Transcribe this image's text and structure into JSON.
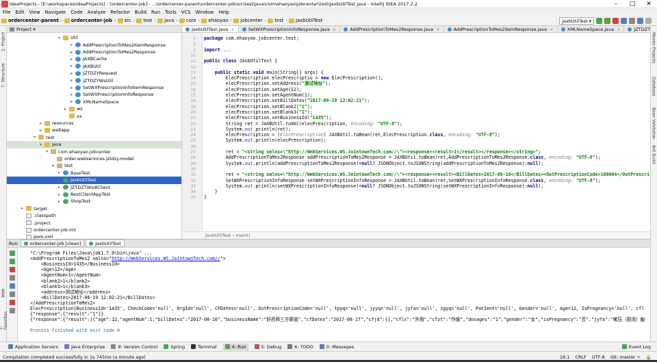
{
  "window": {
    "title": "IdeaProjects - [E:\\workspaces\\IdeaProjects] - [ordercenter-job] - ...\\ordercenter-parent\\ordercenter-job\\src\\test\\java\\com\\ehaoyao\\jobcenter\\test\\JaxbUtilTest.java - IntelliJ IDEA 2017.2.2"
  },
  "menu": [
    "File",
    "Edit",
    "View",
    "Navigate",
    "Code",
    "Analyze",
    "Refactor",
    "Build",
    "Run",
    "Tools",
    "VCS",
    "Window",
    "Help"
  ],
  "breadcrumbs": [
    "ordercenter-parent",
    "ordercenter-job",
    "src",
    "test",
    "java",
    "com",
    "ehaoyao",
    "jobcenter",
    "test",
    "JaxbUtilTest"
  ],
  "run_config": "JaxbUtilTest",
  "project_panel": {
    "label": "Project"
  },
  "tree": [
    {
      "label": "Util",
      "depth": 9,
      "type": "fld",
      "arrow": "▾"
    },
    {
      "label": "AddPrescriptionToMes2ItemResponse",
      "depth": 11,
      "type": "cls",
      "arrow": "▸"
    },
    {
      "label": "AddPrescriptionToMes2Response",
      "depth": 11,
      "type": "cls",
      "arrow": "▸"
    },
    {
      "label": "JAXBCache",
      "depth": 11,
      "type": "cls",
      "arrow": "▸"
    },
    {
      "label": "JAXBUtil",
      "depth": 11,
      "type": "cls",
      "arrow": "▸"
    },
    {
      "label": "JZTDZYRequest",
      "depth": 11,
      "type": "cls",
      "arrow": "▸"
    },
    {
      "label": "JZTDZYWsUtil",
      "depth": 11,
      "type": "cls",
      "arrow": "▸"
    },
    {
      "label": "SetWXPrescriptionInfoItemResponse",
      "depth": 11,
      "type": "cls",
      "arrow": "▸"
    },
    {
      "label": "SetWXPrescriptionInfoResponse",
      "depth": 11,
      "type": "cls",
      "arrow": "▸"
    },
    {
      "label": "XMLNameSpace",
      "depth": 11,
      "type": "cls",
      "arrow": "▸"
    },
    {
      "label": "ws",
      "depth": 10,
      "type": "fld",
      "arrow": "▸"
    },
    {
      "label": "xx",
      "depth": 10,
      "type": "fld",
      "arrow": ""
    },
    {
      "label": "resources",
      "depth": 6,
      "type": "fld",
      "arrow": "▸"
    },
    {
      "label": "webapp",
      "depth": 6,
      "type": "fld",
      "arrow": "▸"
    },
    {
      "label": "test",
      "depth": 5,
      "type": "fld",
      "arrow": "▾"
    },
    {
      "label": "java",
      "depth": 6,
      "type": "fld",
      "arrow": "▾",
      "hl": true
    },
    {
      "label": "com.ehaoyao.jobcenter",
      "depth": 7,
      "type": "pkg",
      "arrow": "▾"
    },
    {
      "label": "order.webservices.jztdzy.model",
      "depth": 8,
      "type": "pkg",
      "arrow": ""
    },
    {
      "label": "test",
      "depth": 8,
      "type": "pkg",
      "arrow": "▾"
    },
    {
      "label": "BaseTest",
      "depth": 9,
      "type": "cls",
      "arrow": "▸"
    },
    {
      "label": "JaxbUtilTest",
      "depth": 9,
      "type": "jun",
      "arrow": "▸",
      "sel": true
    },
    {
      "label": "JZTDZTWsdlClient",
      "depth": 9,
      "type": "jun",
      "arrow": "▸"
    },
    {
      "label": "RestClientAppTest",
      "depth": 9,
      "type": "jun",
      "arrow": "▸"
    },
    {
      "label": "ShopTest",
      "depth": 9,
      "type": "jun",
      "arrow": "▸"
    },
    {
      "label": "target",
      "depth": 3,
      "type": "fld",
      "arrow": "▸"
    },
    {
      "label": ".classpath",
      "depth": 3,
      "type": "file",
      "arrow": ""
    },
    {
      "label": ".project",
      "depth": 3,
      "type": "file",
      "arrow": ""
    },
    {
      "label": "ordercenter-job.iml",
      "depth": 3,
      "type": "file",
      "arrow": ""
    },
    {
      "label": "pom.xml",
      "depth": 3,
      "type": "file",
      "arrow": ""
    }
  ],
  "editor_tabs": [
    {
      "label": "JaxbUtilTest.java",
      "active": true
    },
    {
      "label": "SetWXPrescriptionInfoResponse.java"
    },
    {
      "label": "AddPrescriptionToMes2Response.java"
    },
    {
      "label": "AddPrescriptionToMes2ItemResponse.java"
    },
    {
      "label": "XMLNameSpace.java"
    },
    {
      "label": "JZTDZTWsdlClient.java"
    }
  ],
  "code": [
    {
      "n": "1",
      "html": "<span class='kw'>package</span> com.ehaoyao.jobcenter.test;"
    },
    {
      "n": "2",
      "html": ""
    },
    {
      "n": "3",
      "html": "<span class='kw'>import</span> ..."
    },
    {
      "n": "10",
      "html": ""
    },
    {
      "n": "11",
      "html": "<span class='kw'>public class</span> JaxbUtilTest {"
    },
    {
      "n": "12",
      "html": ""
    },
    {
      "n": "13",
      "html": "    <span class='kw'>public static void</span> main(String[] args) {"
    },
    {
      "n": "14",
      "html": "        ElecPrescription elecPrescriptio = <span class='kw'>new</span> ElecPrescription();"
    },
    {
      "n": "15",
      "html": "        elecPrescription.setAddress(<span class='st'>\"测试地址\"</span>);"
    },
    {
      "n": "16",
      "html": "        elecPrescription.setAge(<span class='st'>12</span>);"
    },
    {
      "n": "17",
      "html": "        elecPrescription.setAgentNum(<span class='st'>1</span>);"
    },
    {
      "n": "18",
      "html": "        elecPrescription.setBillDates(<span class='st'>\"2017-08-19 12:02:21\"</span>);"
    },
    {
      "n": "19",
      "html": "        elecPrescription.setBlank2(<span class='st'>\"1\"</span>);"
    },
    {
      "n": "20",
      "html": "        elecPrescription.setBlank3(<span class='st'>\"1\"</span>);"
    },
    {
      "n": "21",
      "html": "        elecPrescription.setBusinessId(<span class='st'>\"1435\"</span>);"
    },
    {
      "n": "22",
      "html": "        String ret = JAXBUtil.<i>toXml</i>(elecPrescription, <span class='hint'>encoding:</span> <span class='st'>\"UTF-8\"</span>);"
    },
    {
      "n": "23",
      "html": "        System.<span class='fld2'>out</span>.println(ret);"
    },
    {
      "n": "24",
      "html": "        elecPrescription = (<span class='hint'>ElecPrescription</span>) JAXBUtil.<i>toBean</i>(ret,ElecPrescription.<span class='kw'>class</span>, <span class='hint'>encoding:</span> <span class='st'>\"UTF-8\"</span>);"
    },
    {
      "n": "25",
      "html": "        System.<span class='fld2'>out</span>.println(elecPrescription);"
    },
    {
      "n": "26",
      "html": ""
    },
    {
      "n": "27",
      "html": "        ret = <span class='st'>\"&lt;string xmlns=\\\"http://WebServices.WS.JointownTech.com//\\\"&gt;&lt;response&gt;&lt;result&gt;1&lt;/result&gt;&lt;/response&gt;&lt;/string&gt;\"</span>;"
    },
    {
      "n": "28",
      "html": "        AddPrescriptionToMes2Response addPrescriptionToMes2Response = JAXBUtil.<i>toBean</i>(ret,AddPrescriptionToMes2Response.<span class='kw'>class</span>, <span class='hint'>encoding:</span> <span class='st'>\"UTF-8\"</span>);"
    },
    {
      "n": "29",
      "html": "        System.<span class='fld2'>out</span>.println(addPrescriptionToMes2Response!=<span class='kw'>null</span>? JSONObject.<i>toJSONString</i>(addPrescriptionToMes2Response):<span class='kw'>null</span>);"
    },
    {
      "n": "30",
      "html": ""
    },
    {
      "n": "31",
      "html": "        ret = <span class='st'>\"&lt;string xmlns=\\\"http://WebServices.WS.JointownTech.com//\\\"&gt;&lt;response&gt;&lt;result&gt;&lt;BillDates&gt;2017-08-16&lt;/BillDates&gt;&lt;OutPrescriptionCode&gt;100004&lt;/OutPrescri</span>"
    },
    {
      "n": "32",
      "html": "        SetWXPrescriptionInfoResponse setWXPrescriptionInfoResponse = JAXBUtil.<i>toBean</i>(ret,SetWXPrescriptionInfoResponse.<span class='kw'>class</span>, <span class='hint'>encoding:</span> <span class='st'>\"UTF-8\"</span>);"
    },
    {
      "n": "33",
      "html": "        System.<span class='fld2'>out</span>.println(setWXPrescriptionInfoResponse!=<span class='kw'>null</span>? JSONObject.<i>toJSONString</i>(setWXPrescriptionInfoResponse):<span class='kw'>null</span>);"
    },
    {
      "n": "34",
      "html": "    }"
    },
    {
      "n": "35",
      "html": "}"
    }
  ],
  "editor_breadcrumb": "JaxbUtilTest    ›    main()",
  "run": {
    "label": "Run:",
    "tabs": [
      "ordercenter-job [clean]",
      "JaxbUtilTest"
    ]
  },
  "console": [
    {
      "html": "\"C:\\Program Files\\Java\\jdk1.7.0\\bin\\java\" ..."
    },
    {
      "html": "&lt;AddPrescriptionToMes2 xmlns=\"<span class='lnk'>http://WebServices.WS.JointownTech.com//</span>\"&gt;"
    },
    {
      "html": "    &lt;BusinessId&gt;1435&lt;/BusinessId&gt;"
    },
    {
      "html": "    &lt;Age&gt;12&lt;/Age&gt;"
    },
    {
      "html": "    &lt;AgentNum&gt;1&lt;/AgentNum&gt;"
    },
    {
      "html": "    &lt;blank2&gt;1&lt;/blank2&gt;"
    },
    {
      "html": "    &lt;blank3&gt;1&lt;/blank3&gt;"
    },
    {
      "html": "    &lt;address&gt;测试地址&lt;/address&gt;"
    },
    {
      "html": "    &lt;BillDates&gt;2017-08-19 12:02:21&lt;/BillDates&gt;"
    },
    {
      "html": "&lt;/AddPrescriptionToMes2&gt;"
    },
    {
      "html": "ElecPrescription{BusinessId='1435', CheckCode='null', OrgId='null', CFDates='null', OutPrescriptionCode='null', tpyq='null', jyyq='null', jyfa='null', zgyq='null', PatIent='null', Gender='null', Age=12, IsPregnancy='null', cfl"
    },
    {
      "html": "{\"response\":{\"result\":\"1\"}}"
    },
    {
      "html": "{\"response\":{\"result\":[{\"age\":12,\"agentNum\":1,\"billDates\":\"2017-08-16\",\"businessName\":\"好药师三方渠道\",\"cfDates\":\"2017-08-17\",\"cfjd\":{},\"cflx\":\"外用\",\"cfzt\":\"作废\",\"dosages\":\"1\",\"gender\":\"女\",\"isPregnancy\":\"否\",\"jyfa\":\"嗽压（密闭）幽"
    },
    {
      "html": ""
    },
    {
      "html": "Process finished with exit code 0",
      "ok": true
    }
  ],
  "bottom_tabs": [
    {
      "label": "Application Servers",
      "c": "#5a7fb5"
    },
    {
      "label": "Java Enterprise",
      "c": "#8a6bc4"
    },
    {
      "label": "9: Version Control",
      "c": "#888"
    },
    {
      "label": "Spring",
      "c": "#49a55b"
    },
    {
      "label": "Terminal",
      "c": "#333"
    },
    {
      "label": "4: Run",
      "c": "#49a55b",
      "active": true
    },
    {
      "label": "5: Debug",
      "c": "#b55"
    },
    {
      "label": "6: TODO",
      "c": "#777"
    },
    {
      "label": "0: Messages",
      "c": "#5a7fb5"
    },
    {
      "label": "Event Log",
      "c": "#49a55b",
      "right": true
    }
  ],
  "status": {
    "message": "Compilation completed successfully in 1s 745ms (a minute ago)",
    "position": "16:1",
    "line_sep": "CRLF",
    "encoding": "UTF-8",
    "git": "Git: master ÷"
  },
  "side_tabs": {
    "left": [
      "1: Project",
      "7: Structure",
      "Web",
      "2: Favorites"
    ],
    "right": [
      "Maven Projects",
      "Database",
      "Bean Validation",
      "Ant Build"
    ]
  }
}
